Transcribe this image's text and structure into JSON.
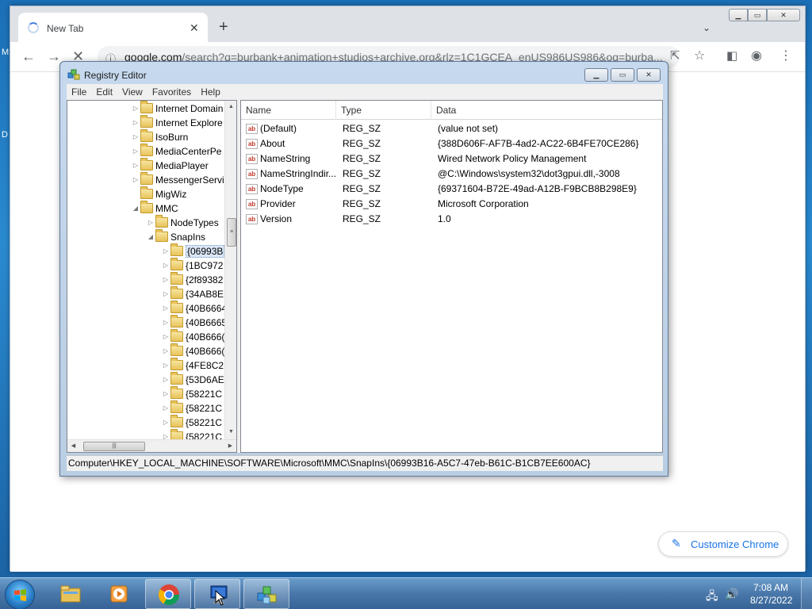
{
  "desktop": {
    "edge_text_1": "M",
    "edge_text_2": "D"
  },
  "chrome": {
    "tab_title": "New Tab",
    "tab_close": "✕",
    "new_tab": "+",
    "tab_search": "⌄",
    "url_host": "google.com",
    "url_path": "/search?q=burbank+animation+studios+archive.org&rlz=1C1GCEA_enUS986US986&oq=burba...",
    "customize_label": "Customize Chrome",
    "window_controls": [
      "▁",
      "▭",
      "✕"
    ]
  },
  "regedit": {
    "title": "Registry Editor",
    "controls": [
      "▁",
      "▭",
      "✕"
    ],
    "menu": [
      "File",
      "Edit",
      "View",
      "Favorites",
      "Help"
    ],
    "tree": [
      {
        "label": "Internet Domain",
        "indent": 0,
        "exp": "▷"
      },
      {
        "label": "Internet Explore",
        "indent": 0,
        "exp": "▷"
      },
      {
        "label": "IsoBurn",
        "indent": 0,
        "exp": "▷"
      },
      {
        "label": "MediaCenterPe",
        "indent": 0,
        "exp": "▷"
      },
      {
        "label": "MediaPlayer",
        "indent": 0,
        "exp": "▷"
      },
      {
        "label": "MessengerServi",
        "indent": 0,
        "exp": "▷"
      },
      {
        "label": "MigWiz",
        "indent": 0,
        "exp": ""
      },
      {
        "label": "MMC",
        "indent": 0,
        "exp": "◢"
      },
      {
        "label": "NodeTypes",
        "indent": 1,
        "exp": "▷"
      },
      {
        "label": "SnapIns",
        "indent": 1,
        "exp": "◢"
      },
      {
        "label": "{06993B",
        "indent": 2,
        "exp": "▷",
        "selected": true
      },
      {
        "label": "{1BC972",
        "indent": 2,
        "exp": "▷"
      },
      {
        "label": "{2f89382",
        "indent": 2,
        "exp": "▷"
      },
      {
        "label": "{34AB8E",
        "indent": 2,
        "exp": "▷"
      },
      {
        "label": "{40B6664",
        "indent": 2,
        "exp": "▷"
      },
      {
        "label": "{40B6665",
        "indent": 2,
        "exp": "▷"
      },
      {
        "label": "{40B666(",
        "indent": 2,
        "exp": "▷"
      },
      {
        "label": "{40B666(",
        "indent": 2,
        "exp": "▷"
      },
      {
        "label": "{4FE8C2",
        "indent": 2,
        "exp": "▷"
      },
      {
        "label": "{53D6AE",
        "indent": 2,
        "exp": "▷"
      },
      {
        "label": "{58221C",
        "indent": 2,
        "exp": "▷"
      },
      {
        "label": "{58221C",
        "indent": 2,
        "exp": "▷"
      },
      {
        "label": "{58221C",
        "indent": 2,
        "exp": "▷"
      },
      {
        "label": "{58221C",
        "indent": 2,
        "exp": "▷"
      }
    ],
    "columns": [
      "Name",
      "Type",
      "Data"
    ],
    "values": [
      {
        "name": "(Default)",
        "type": "REG_SZ",
        "data": "(value not set)"
      },
      {
        "name": "About",
        "type": "REG_SZ",
        "data": "{388D606F-AF7B-4ad2-AC22-6B4FE70CE286}"
      },
      {
        "name": "NameString",
        "type": "REG_SZ",
        "data": "Wired Network Policy Management"
      },
      {
        "name": "NameStringIndir...",
        "type": "REG_SZ",
        "data": "@C:\\Windows\\system32\\dot3gpui.dll,-3008"
      },
      {
        "name": "NodeType",
        "type": "REG_SZ",
        "data": "{69371604-B72E-49ad-A12B-F9BCB8B298E9}"
      },
      {
        "name": "Provider",
        "type": "REG_SZ",
        "data": "Microsoft Corporation"
      },
      {
        "name": "Version",
        "type": "REG_SZ",
        "data": "1.0"
      }
    ],
    "value_icon": "ab",
    "status_path": "Computer\\HKEY_LOCAL_MACHINE\\SOFTWARE\\Microsoft\\MMC\\SnapIns\\{06993B16-A5C7-47eb-B61C-B1CB7EE600AC}"
  },
  "taskbar": {
    "time": "7:08 AM",
    "date": "8/27/2022"
  }
}
